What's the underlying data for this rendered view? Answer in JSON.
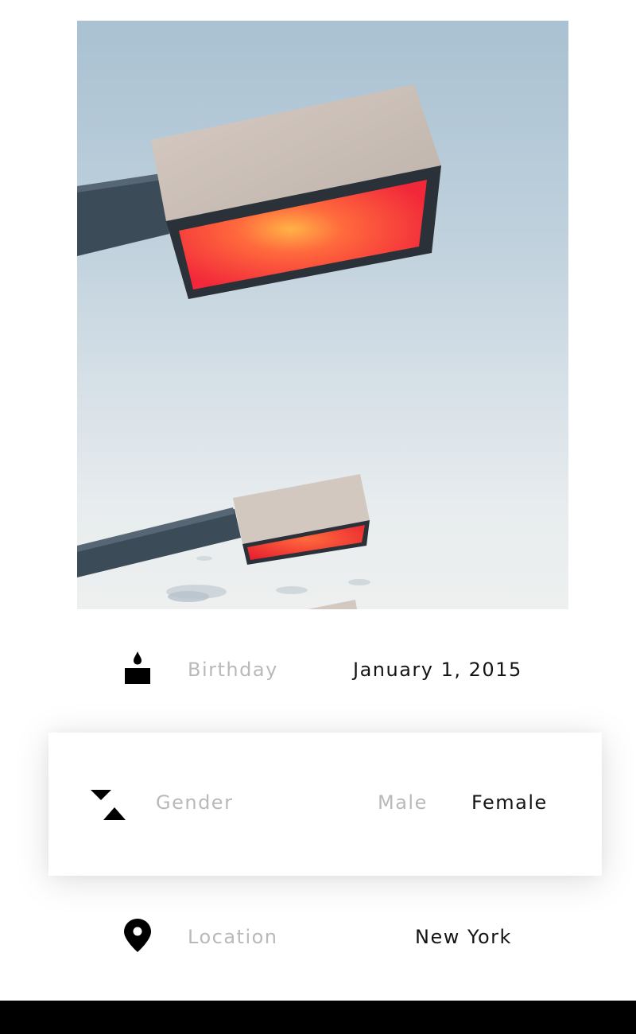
{
  "profile": {
    "photo": {
      "camera_icon": "camera-icon"
    },
    "birthday": {
      "icon": "candle-icon",
      "label": "Birthday",
      "value": "January 1, 2015"
    },
    "gender": {
      "icon": "gender-icon",
      "label": "Gender",
      "options": [
        "Male",
        "Female"
      ],
      "selected": "Female"
    },
    "location": {
      "icon": "location-pin-icon",
      "label": "Location",
      "value": "New York"
    }
  },
  "colors": {
    "label": "#b9b9b9",
    "value": "#141414",
    "icon": "#000000",
    "lamp_glow": "#ff3b3b",
    "bottom_bar": "#000000"
  }
}
